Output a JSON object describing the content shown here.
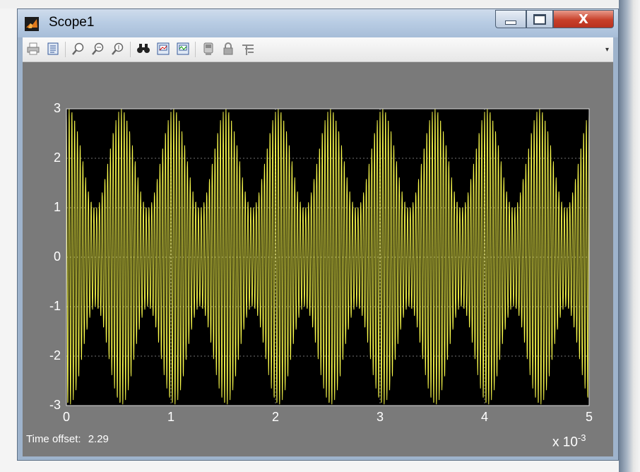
{
  "window": {
    "title": "Scope1",
    "close_glyph": "X"
  },
  "toolbar": {
    "icons": [
      "print-icon",
      "parameters-icon",
      "zoom-icon",
      "zoom-x-icon",
      "zoom-y-icon",
      "autoscale-icon",
      "save-axes-icon",
      "restore-axes-icon",
      "floating-scope-icon",
      "lock-axes-icon",
      "signal-selection-icon"
    ],
    "more_glyph": "▾"
  },
  "chart_data": {
    "type": "line",
    "title": "",
    "xlabel": "",
    "ylabel": "",
    "x_multiplier": "×10^-3",
    "xlim": [
      0,
      5
    ],
    "ylim": [
      -3,
      3
    ],
    "grid": true,
    "background": "#000000",
    "line_color": "#ffff4d",
    "xticks": [
      "0",
      "1",
      "2",
      "3",
      "4",
      "5"
    ],
    "yticks": [
      "3",
      "2",
      "1",
      "0",
      "-1",
      "-2",
      "-3"
    ],
    "series": [
      {
        "description": "amplitude-modulated carrier",
        "carrier_amplitude": 2,
        "modulation_amplitude": 1,
        "envelope_peaks": 10,
        "envelope_range": [
          1,
          3
        ]
      }
    ]
  },
  "status": {
    "time_offset_label": "Time offset:",
    "time_offset_value": "2.29",
    "exponent_base": "x 10",
    "exponent_power": "-3"
  }
}
